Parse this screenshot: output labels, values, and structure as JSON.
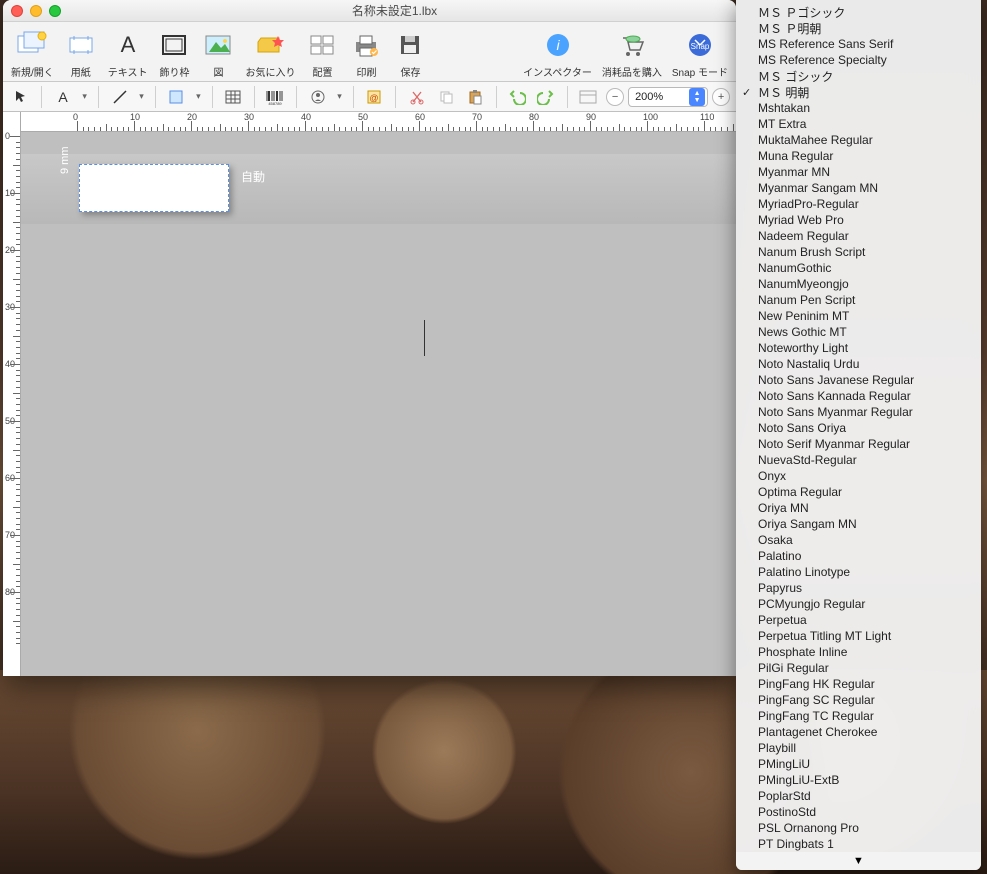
{
  "window": {
    "title": "名称未設定1.lbx"
  },
  "toolbar": {
    "new_open": "新規/開く",
    "paper": "用紙",
    "text": "テキスト",
    "frame": "飾り枠",
    "image": "図",
    "favorites": "お気に入り",
    "arrange": "配置",
    "print": "印刷",
    "save": "保存",
    "inspector": "インスペクター",
    "supplies": "消耗品を購入",
    "snap": "Snap モード"
  },
  "zoom": {
    "value": "200%"
  },
  "ruler": {
    "unit": "mm",
    "topTicks": [
      "0",
      "10",
      "20",
      "30",
      "40",
      "50",
      "60",
      "70",
      "80",
      "90",
      "100",
      "110"
    ],
    "leftTicks": [
      "0",
      "10",
      "20",
      "30",
      "40",
      "50",
      "60",
      "70",
      "80"
    ]
  },
  "label": {
    "size": "9 mm",
    "auto": "自動"
  },
  "fontMenu": {
    "selected": "ＭＳ 明朝",
    "items": [
      "ＭＳ Ｐゴシック",
      "ＭＳ Ｐ明朝",
      "MS Reference Sans Serif",
      "MS Reference Specialty",
      "ＭＳ ゴシック",
      "ＭＳ 明朝",
      "Mshtakan",
      "MT Extra",
      "MuktaMahee Regular",
      "Muna Regular",
      "Myanmar MN",
      "Myanmar Sangam MN",
      "MyriadPro-Regular",
      "Myriad Web Pro",
      "Nadeem Regular",
      "Nanum Brush Script",
      "NanumGothic",
      "NanumMyeongjo",
      "Nanum Pen Script",
      "New Peninim MT",
      "News Gothic MT",
      "Noteworthy Light",
      "Noto Nastaliq Urdu",
      "Noto Sans Javanese Regular",
      "Noto Sans Kannada Regular",
      "Noto Sans Myanmar Regular",
      "Noto Sans Oriya",
      "Noto Serif Myanmar Regular",
      "NuevaStd-Regular",
      "Onyx",
      "Optima Regular",
      "Oriya MN",
      "Oriya Sangam MN",
      "Osaka",
      "Palatino",
      "Palatino Linotype",
      "Papyrus",
      "PCMyungjo Regular",
      "Perpetua",
      "Perpetua Titling MT Light",
      "Phosphate Inline",
      "PilGi Regular",
      "PingFang HK Regular",
      "PingFang SC Regular",
      "PingFang TC Regular",
      "Plantagenet Cherokee",
      "Playbill",
      "PMingLiU",
      "PMingLiU-ExtB",
      "PoplarStd",
      "PostinoStd",
      "PSL Ornanong Pro",
      "PT Dingbats 1"
    ]
  }
}
